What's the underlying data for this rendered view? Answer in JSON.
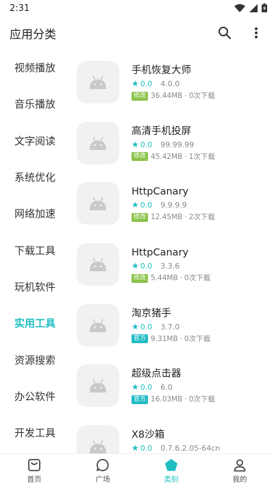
{
  "status_bar": {
    "time": "2:31"
  },
  "app_bar": {
    "title": "应用分类"
  },
  "sidebar": {
    "items": [
      {
        "label": "视频播放",
        "active": false
      },
      {
        "label": "音乐播放",
        "active": false
      },
      {
        "label": "文字阅读",
        "active": false
      },
      {
        "label": "系统优化",
        "active": false
      },
      {
        "label": "网络加速",
        "active": false
      },
      {
        "label": "下载工具",
        "active": false
      },
      {
        "label": "玩机软件",
        "active": false
      },
      {
        "label": "实用工具",
        "active": true
      },
      {
        "label": "资源搜索",
        "active": false
      },
      {
        "label": "办公软件",
        "active": false
      },
      {
        "label": "开发工具",
        "active": false
      }
    ]
  },
  "apps": [
    {
      "name": "手机恢复大师",
      "rating": "0.0",
      "version": "4.0.0",
      "tag": "修改",
      "tag_type": "mod",
      "size": "36.44MB",
      "downloads": "0次下载"
    },
    {
      "name": "高清手机投屏",
      "rating": "0.0",
      "version": "99.99.99",
      "tag": "修改",
      "tag_type": "mod",
      "size": "45.42MB",
      "downloads": "1次下载"
    },
    {
      "name": "HttpCanary",
      "rating": "0.0",
      "version": "9.9.9.9",
      "tag": "修改",
      "tag_type": "mod",
      "size": "12.45MB",
      "downloads": "2次下载"
    },
    {
      "name": "HttpCanary",
      "rating": "0.0",
      "version": "3.3.6",
      "tag": "修改",
      "tag_type": "mod",
      "size": "5.44MB",
      "downloads": "0次下载"
    },
    {
      "name": "淘京猪手",
      "rating": "0.0",
      "version": "3.7.0",
      "tag": "官方",
      "tag_type": "official",
      "size": "9.31MB",
      "downloads": "0次下载"
    },
    {
      "name": "超级点击器",
      "rating": "0.0",
      "version": "6.0",
      "tag": "官方",
      "tag_type": "official",
      "size": "16.03MB",
      "downloads": "0次下载"
    },
    {
      "name": "X8沙箱",
      "rating": "0.0",
      "version": "0.7.6.2.05-64cn",
      "tag": "",
      "tag_type": "",
      "size": "",
      "downloads": ""
    }
  ],
  "bottom_nav": {
    "items": [
      {
        "label": "首页",
        "icon": "home-icon",
        "active": false
      },
      {
        "label": "广场",
        "icon": "chat-bubble-icon",
        "active": false
      },
      {
        "label": "类别",
        "icon": "pentagon-icon",
        "active": true
      },
      {
        "label": "我的",
        "icon": "person-icon",
        "active": false
      }
    ]
  },
  "colors": {
    "accent": "#1fbfc2",
    "mod_tag": "#8bc34a",
    "official_tag": "#21bcc4",
    "active_bg": "#e6f8f8"
  }
}
